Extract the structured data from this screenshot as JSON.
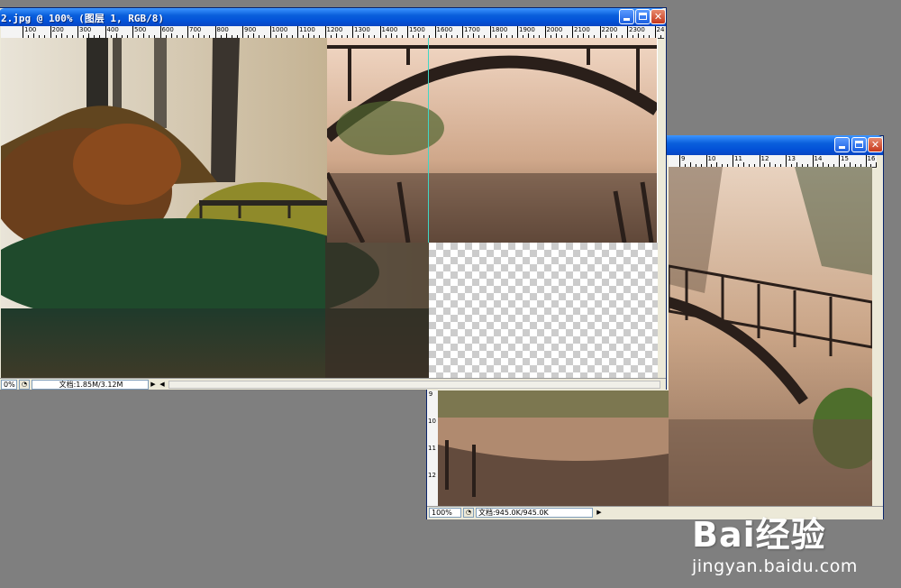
{
  "window_main": {
    "title": "2.jpg @ 100% (图层 1, RGB/8)",
    "ruler_ticks": [
      "100",
      "200",
      "300",
      "400",
      "500",
      "600",
      "700",
      "800",
      "900",
      "1000",
      "1100",
      "1200",
      "1300",
      "1400",
      "1500",
      "1600",
      "1700",
      "1800",
      "1900",
      "2000",
      "2100",
      "2200",
      "2300",
      "2400"
    ],
    "status": {
      "zoom": "0%",
      "doc_info": "文档:1.85M/3.12M"
    }
  },
  "window_second": {
    "ruler_ticks": [
      "9",
      "10",
      "11",
      "12",
      "13",
      "14",
      "15",
      "16"
    ],
    "vruler_ticks": [
      "9",
      "10",
      "11",
      "12"
    ],
    "status": {
      "zoom": "100%",
      "doc_info": "文档:945.0K/945.0K"
    }
  },
  "watermark": {
    "brand": "Bai经验",
    "url": "jingyan.baidu.com"
  },
  "colors": {
    "desktop": "#7f7f7f",
    "titlebar": "#0352d8",
    "chrome": "#ece9d8"
  }
}
